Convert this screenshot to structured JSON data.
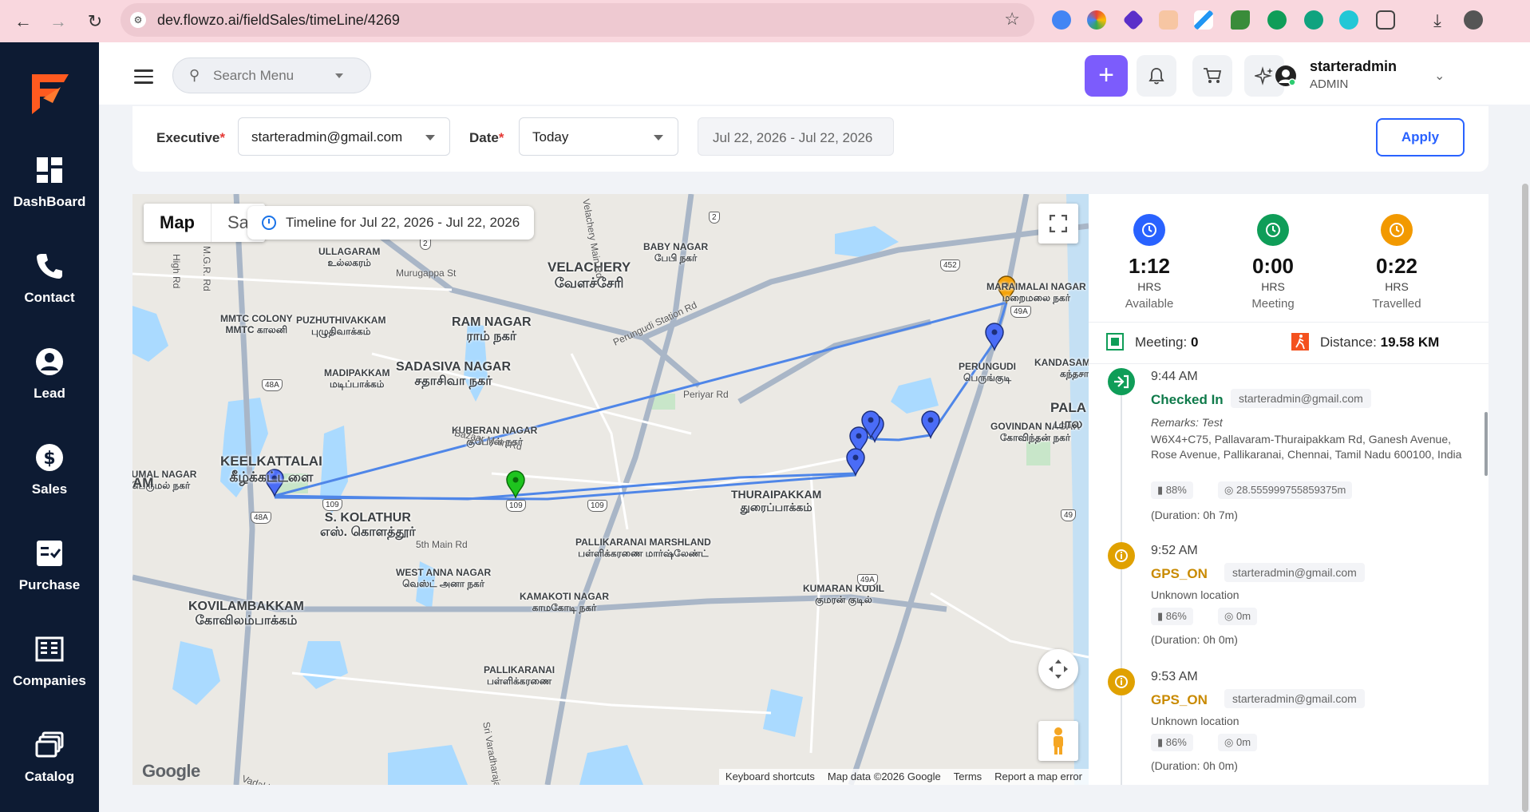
{
  "browser": {
    "url": "dev.flowzo.ai/fieldSales/timeLine/4269"
  },
  "sidebar": {
    "items": [
      {
        "label": "DashBoard",
        "icon": "dashboard-icon"
      },
      {
        "label": "Contact",
        "icon": "phone-icon"
      },
      {
        "label": "Lead",
        "icon": "user-icon"
      },
      {
        "label": "Sales",
        "icon": "dollar-icon"
      },
      {
        "label": "Purchase",
        "icon": "checklist-icon"
      },
      {
        "label": "Companies",
        "icon": "building-icon"
      },
      {
        "label": "Catalog",
        "icon": "catalog-icon"
      }
    ]
  },
  "header": {
    "search_placeholder": "Search Menu",
    "user_name": "starteradmin",
    "user_role": "ADMIN"
  },
  "filters": {
    "executive_label": "Executive",
    "executive_value": "starteradmin@gmail.com",
    "date_label": "Date",
    "date_value": "Today",
    "date_range": "Jul 22, 2026 - Jul 22, 2026",
    "apply_label": "Apply"
  },
  "map": {
    "tab_map": "Map",
    "tab_satellite": "Sa",
    "timeline_label": "Timeline for Jul 22, 2026 - Jul 22, 2026",
    "google": "Google",
    "attribution": [
      "Keyboard shortcuts",
      "Map data ©2026 Google",
      "Terms",
      "Report a map error"
    ],
    "places": [
      {
        "name": "VELACHERY",
        "local": "வேளச்சேரி"
      },
      {
        "name": "RAM NAGAR",
        "local": "ராம் நகர்"
      },
      {
        "name": "SADASIVA NAGAR",
        "local": "சதாசிவா நகர்"
      },
      {
        "name": "KEELKATTALAI",
        "local": "கீழ்க்கட்டளை"
      },
      {
        "name": "S. KOLATHUR",
        "local": "எஸ். கொளத்தூர்"
      },
      {
        "name": "THURAIPAKKAM",
        "local": "துரைப்பாக்கம்"
      },
      {
        "name": "KOVILAMBAKKAM",
        "local": "கோவிலம்பாக்கம்"
      },
      {
        "name": "PALLIKARANAI MARSHLAND",
        "local": "பள்ளிக்கரணை மார்ஷ்லேண்ட்"
      },
      {
        "name": "ULLAGARAM",
        "local": "உல்லகரம்"
      },
      {
        "name": "PUZHUTHIVAKKAM",
        "local": "புழுதிவாக்கம்"
      },
      {
        "name": "MADIPAKKAM",
        "local": "மடிப்பாக்கம்"
      },
      {
        "name": "KUBERAN NAGAR",
        "local": "குபேரன் நகர்"
      },
      {
        "name": "BABY NAGAR",
        "local": "பேபி நகர்"
      },
      {
        "name": "MARAIMALAI NAGAR",
        "local": "மறைமலை நகர்"
      },
      {
        "name": "PERUNGUDI",
        "local": "பெருங்குடி"
      },
      {
        "name": "KANDASAMY NAGAR",
        "local": "கந்தசா நகர்"
      },
      {
        "name": "GOVINDAN NAGAR",
        "local": "கோவிந்தன் நகர்"
      },
      {
        "name": "WEST ANNA NAGAR",
        "local": "வெஸ்ட் அனா நகர்"
      },
      {
        "name": "KAMAKOTI NAGAR",
        "local": "காமகோடி நகர்"
      },
      {
        "name": "KUMARAN KUDIL",
        "local": "குமரன் குடில்"
      },
      {
        "name": "PALLIKARANAI",
        "local": "பள்ளிக்கரணை"
      },
      {
        "name": "MMTC COLONY",
        "local": "MMTC காலனி"
      },
      {
        "name": "RUMAL NAGAR",
        "local": "பெருமல் நகர்"
      },
      {
        "name": "PALA",
        "local": "பால"
      }
    ],
    "roads": [
      "Murugappa St",
      "Perungudi Station Rd",
      "Periyar Rd",
      "Bazaar Main Rd",
      "5th Main Rd",
      "M.G.R. Rd",
      "High Rd",
      "Velachery Main Rd",
      "Sri Varadharajan Rd",
      "Vadakku"
    ],
    "shields": [
      "2",
      "2",
      "452",
      "49A",
      "48A",
      "109",
      "109",
      "109",
      "48A",
      "49A",
      "49"
    ],
    "map_fragment_labels": [
      "AM"
    ]
  },
  "stats": [
    {
      "value": "1:12",
      "unit": "HRS",
      "caption": "Available",
      "color": "#2962ff"
    },
    {
      "value": "0:00",
      "unit": "HRS",
      "caption": "Meeting",
      "color": "#0f9d58"
    },
    {
      "value": "0:22",
      "unit": "HRS",
      "caption": "Travelled",
      "color": "#f29900"
    }
  ],
  "summary": {
    "meeting_label": "Meeting:",
    "meeting_value": "0",
    "distance_label": "Distance:",
    "distance_value": "19.58 KM"
  },
  "timeline": [
    {
      "time": "9:44 AM",
      "status": "Checked In",
      "status_color": "#0f7a4a",
      "email": "starteradmin@gmail.com",
      "remarks": "Remarks: Test",
      "address": "W6X4+C75, Pallavaram-Thuraipakkam Rd, Ganesh Avenue, Rose Avenue, Pallikaranai, Chennai, Tamil Nadu 600100, India",
      "battery": "88%",
      "accuracy": "28.555999755859375m",
      "duration": "(Duration: 0h 7m)"
    },
    {
      "time": "9:52 AM",
      "status": "GPS_ON",
      "status_color": "#c98a00",
      "email": "starteradmin@gmail.com",
      "address": "Unknown location",
      "battery": "86%",
      "accuracy": "0m",
      "duration": "(Duration: 0h 0m)"
    },
    {
      "time": "9:53 AM",
      "status": "GPS_ON",
      "status_color": "#c98a00",
      "email": "starteradmin@gmail.com",
      "address": "Unknown location",
      "battery": "86%",
      "accuracy": "0m",
      "duration": "(Duration: 0h 0m)"
    }
  ]
}
